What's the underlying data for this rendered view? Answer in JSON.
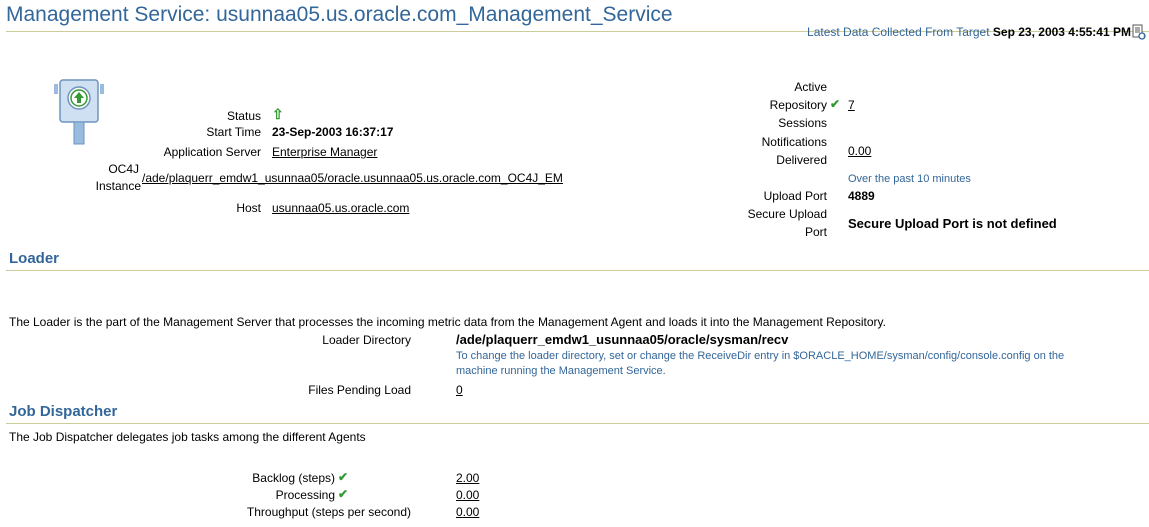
{
  "page": {
    "title": "Management Service: usunnaa05.us.oracle.com_Management_Service",
    "collected_label": "Latest Data Collected From Target",
    "collected_time": "Sep 23, 2003 4:55:41 PM",
    "refresh_icon": "refresh-icon"
  },
  "general": {
    "status_label": "Status",
    "status_icon": "status-up-icon",
    "start_time_label": "Start Time",
    "start_time": "23-Sep-2003 16:37:17",
    "app_server_label": "Application Server",
    "app_server": "Enterprise Manager",
    "oc4j_label_1": "OC4J",
    "oc4j_label_2": "Instance",
    "oc4j_value": "/ade/plaquerr_emdw1_usunnaa05/oracle.usunnaa05.us.oracle.com_OC4J_EM",
    "host_label": "Host",
    "host_value": "usunnaa05.us.oracle.com"
  },
  "right": {
    "active_label_1": "Active",
    "active_label_2": "Repository",
    "active_label_3": "Sessions",
    "active_value": "7",
    "notif_label_1": "Notifications",
    "notif_label_2": "Delivered",
    "notif_value": "0.00",
    "notif_hint": "Over the past 10 minutes",
    "upload_port_label": "Upload Port",
    "upload_port_value": "4889",
    "secure_label_1": "Secure Upload",
    "secure_label_2": "Port",
    "secure_value": "Secure Upload Port is not defined"
  },
  "loader": {
    "heading": "Loader",
    "description": "The Loader is the part of the Management Server that processes the incoming metric data from the Management Agent and loads it into the Management Repository.",
    "dir_label": "Loader Directory",
    "dir_value": "/ade/plaquerr_emdw1_usunnaa05/oracle/sysman/recv",
    "dir_hint_1": "To change the loader directory, set or change the ReceiveDir entry in $ORACLE_HOME/sysman/config/console.config on the",
    "dir_hint_2": "machine running the Management Service.",
    "pending_label": "Files Pending Load",
    "pending_value": "0"
  },
  "dispatcher": {
    "heading": "Job Dispatcher",
    "description": "The Job Dispatcher delegates job tasks among the different Agents",
    "backlog_label": "Backlog (steps)",
    "backlog_value": "2.00",
    "processing_label": "Processing",
    "processing_value": "0.00",
    "throughput_label": "Throughput (steps per second)",
    "throughput_value": "0.00"
  },
  "colors": {
    "heading": "#336699",
    "rule": "#cccc99",
    "ok": "#339933"
  }
}
